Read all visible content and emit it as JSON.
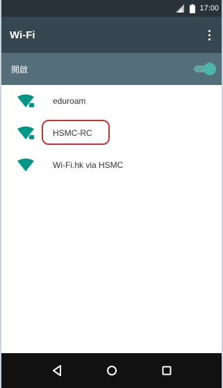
{
  "status_bar": {
    "time": "17:00",
    "icons": [
      "signal-icon",
      "battery-icon"
    ]
  },
  "app_bar": {
    "title": "Wi-Fi",
    "menu_icon": "overflow-menu-icon"
  },
  "toggle": {
    "label": "開啟",
    "state": "on"
  },
  "networks": [
    {
      "name": "eduroam",
      "icon": "wifi-locked-icon",
      "highlighted": false
    },
    {
      "name": "HSMC-RC",
      "icon": "wifi-locked-icon",
      "highlighted": true
    },
    {
      "name": "Wi-Fi.hk via HSMC",
      "icon": "wifi-icon",
      "highlighted": false
    }
  ],
  "nav_bar": {
    "buttons": [
      "back-icon",
      "home-icon",
      "recents-icon"
    ]
  },
  "colors": {
    "status_bar": "#283238",
    "app_bar": "#37474f",
    "toggle_bar": "#546e7a",
    "accent": "#009688",
    "highlight": "#d32f2f",
    "nav_bar": "#111111"
  }
}
